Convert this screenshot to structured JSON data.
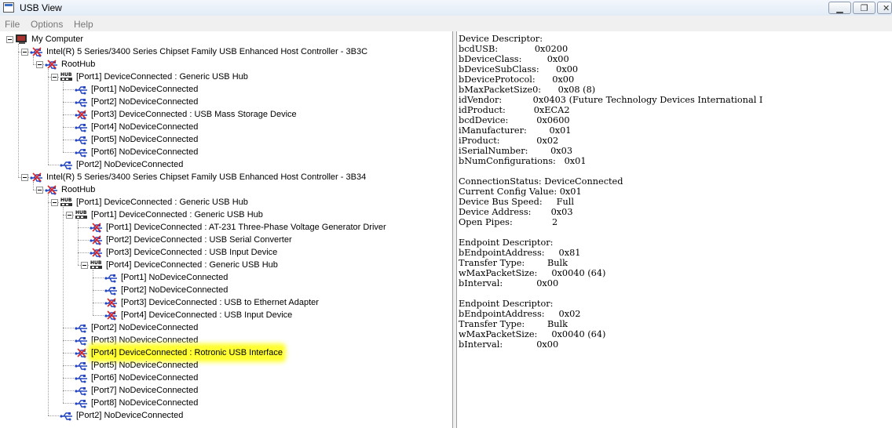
{
  "window": {
    "title": "USB View",
    "buttons": {
      "minimize": "▁",
      "restore": "❐",
      "close": "✕"
    }
  },
  "menu": [
    "File",
    "Options",
    "Help"
  ],
  "tree": [
    {
      "level": 0,
      "icon": "computer-icon",
      "label": "My Computer",
      "expanded": true
    },
    {
      "level": 1,
      "icon": "usb-device-icon",
      "label": "Intel(R) 5 Series/3400 Series Chipset Family USB Enhanced Host Controller - 3B3C",
      "expanded": true
    },
    {
      "level": 2,
      "icon": "usb-device-icon",
      "label": "RootHub",
      "expanded": true
    },
    {
      "level": 3,
      "icon": "usb-hub-icon",
      "label": "[Port1] DeviceConnected :  Generic USB Hub",
      "expanded": true
    },
    {
      "level": 4,
      "icon": "usb-port-icon",
      "label": "[Port1] NoDeviceConnected"
    },
    {
      "level": 4,
      "icon": "usb-port-icon",
      "label": "[Port2] NoDeviceConnected"
    },
    {
      "level": 4,
      "icon": "usb-device-icon",
      "label": "[Port3] DeviceConnected :  USB Mass Storage Device"
    },
    {
      "level": 4,
      "icon": "usb-port-icon",
      "label": "[Port4] NoDeviceConnected"
    },
    {
      "level": 4,
      "icon": "usb-port-icon",
      "label": "[Port5] NoDeviceConnected"
    },
    {
      "level": 4,
      "icon": "usb-port-icon",
      "label": "[Port6] NoDeviceConnected"
    },
    {
      "level": 3,
      "icon": "usb-port-icon",
      "label": "[Port2] NoDeviceConnected"
    },
    {
      "level": 1,
      "icon": "usb-device-icon",
      "label": "Intel(R) 5 Series/3400 Series Chipset Family USB Enhanced Host Controller - 3B34",
      "expanded": true
    },
    {
      "level": 2,
      "icon": "usb-device-icon",
      "label": "RootHub",
      "expanded": true
    },
    {
      "level": 3,
      "icon": "usb-hub-icon",
      "label": "[Port1] DeviceConnected :  Generic USB Hub",
      "expanded": true
    },
    {
      "level": 4,
      "icon": "usb-hub-icon",
      "label": "[Port1] DeviceConnected :  Generic USB Hub",
      "expanded": true
    },
    {
      "level": 5,
      "icon": "usb-device-icon",
      "label": "[Port1] DeviceConnected :  AT-231 Three-Phase Voltage Generator Driver"
    },
    {
      "level": 5,
      "icon": "usb-device-icon",
      "label": "[Port2] DeviceConnected :  USB Serial Converter"
    },
    {
      "level": 5,
      "icon": "usb-device-icon",
      "label": "[Port3] DeviceConnected :  USB Input Device"
    },
    {
      "level": 5,
      "icon": "usb-hub-icon",
      "label": "[Port4] DeviceConnected :  Generic USB Hub",
      "expanded": true
    },
    {
      "level": 6,
      "icon": "usb-port-icon",
      "label": "[Port1] NoDeviceConnected"
    },
    {
      "level": 6,
      "icon": "usb-port-icon",
      "label": "[Port2] NoDeviceConnected"
    },
    {
      "level": 6,
      "icon": "usb-device-icon",
      "label": "[Port3] DeviceConnected :  USB to Ethernet Adapter"
    },
    {
      "level": 6,
      "icon": "usb-device-icon",
      "label": "[Port4] DeviceConnected :  USB Input Device"
    },
    {
      "level": 4,
      "icon": "usb-port-icon",
      "label": "[Port2] NoDeviceConnected"
    },
    {
      "level": 4,
      "icon": "usb-port-icon",
      "label": "[Port3] NoDeviceConnected"
    },
    {
      "level": 4,
      "icon": "usb-device-icon",
      "label": "[Port4] DeviceConnected :  Rotronic USB Interface",
      "highlighted": true
    },
    {
      "level": 4,
      "icon": "usb-port-icon",
      "label": "[Port5] NoDeviceConnected"
    },
    {
      "level": 4,
      "icon": "usb-port-icon",
      "label": "[Port6] NoDeviceConnected"
    },
    {
      "level": 4,
      "icon": "usb-port-icon",
      "label": "[Port7] NoDeviceConnected"
    },
    {
      "level": 4,
      "icon": "usb-port-icon",
      "label": "[Port8] NoDeviceConnected"
    },
    {
      "level": 3,
      "icon": "usb-port-icon",
      "label": "[Port2] NoDeviceConnected"
    }
  ],
  "details": [
    "Device Descriptor:",
    "bcdUSB:             0x0200",
    "bDeviceClass:         0x00",
    "bDeviceSubClass:      0x00",
    "bDeviceProtocol:      0x00",
    "bMaxPacketSize0:      0x08 (8)",
    "idVendor:           0x0403 (Future Technology Devices International I",
    "idProduct:          0xECA2",
    "bcdDevice:          0x0600",
    "iManufacturer:        0x01",
    "iProduct:             0x02",
    "iSerialNumber:        0x03",
    "bNumConfigurations:   0x01",
    "",
    "ConnectionStatus: DeviceConnected",
    "Current Config Value: 0x01",
    "Device Bus Speed:     Full",
    "Device Address:       0x03",
    "Open Pipes:              2",
    "",
    "Endpoint Descriptor:",
    "bEndpointAddress:     0x81",
    "Transfer Type:        Bulk",
    "wMaxPacketSize:     0x0040 (64)",
    "bInterval:            0x00",
    "",
    "Endpoint Descriptor:",
    "bEndpointAddress:     0x02",
    "Transfer Type:        Bulk",
    "wMaxPacketSize:     0x0040 (64)",
    "bInterval:            0x00"
  ]
}
